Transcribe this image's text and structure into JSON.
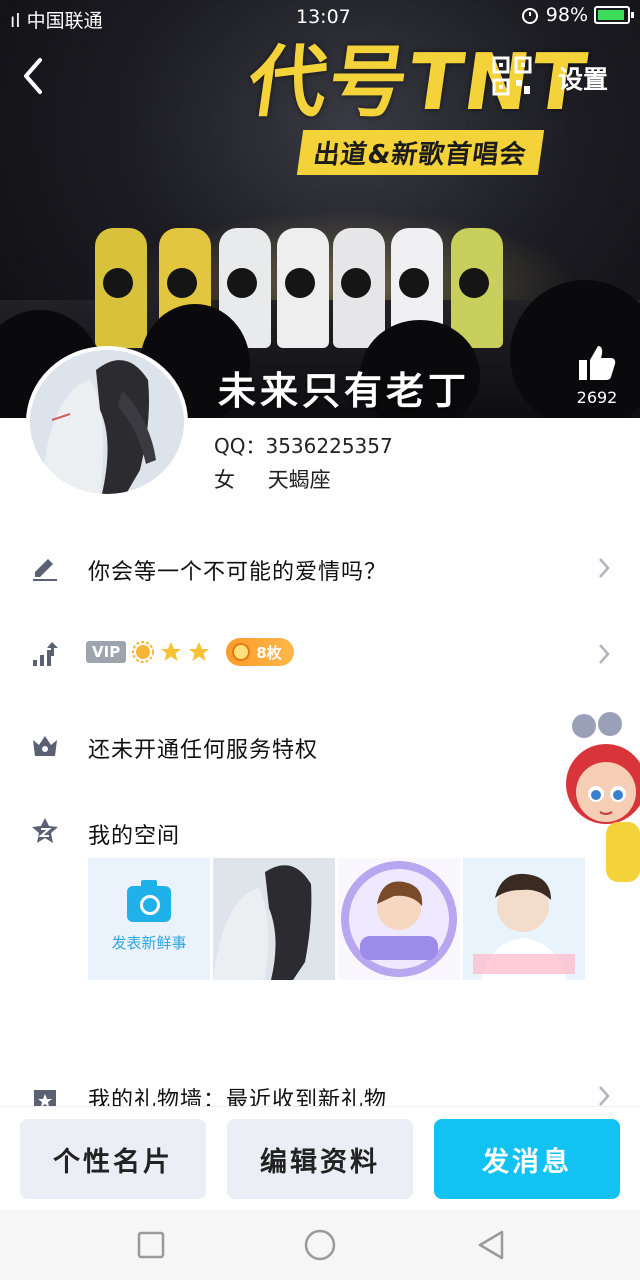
{
  "status_bar": {
    "carrier": "ıl 中国联通",
    "time": "13:07",
    "battery": "98%",
    "icons": [
      "signal-icon",
      "wifi-icon",
      "alarm-icon",
      "battery-icon"
    ]
  },
  "header": {
    "back_icon": "chevron-left-icon",
    "qr_icon": "qr-code-icon",
    "settings_label": "设置",
    "cover_logo": "代号TNT",
    "cover_subtitle": "出道&新歌首唱会"
  },
  "profile": {
    "nickname": "未来只有老丁",
    "like_icon": "thumbs-up-icon",
    "like_count": "2692",
    "qq_label": "QQ：3536225357",
    "gender": "女",
    "constellation": "天蝎座"
  },
  "rows": {
    "signature": {
      "icon": "pencil-icon",
      "text": "你会等一个不可能的爱情吗？"
    },
    "level": {
      "icon": "level-up-icon",
      "vip": "VIP",
      "medal_count": "8枚"
    },
    "services": {
      "icon": "crown-icon",
      "text": "还未开通任何服务特权"
    },
    "space": {
      "icon": "qzone-icon",
      "text": "我的空间",
      "post_label": "发表新鲜事",
      "photos": [
        "photo-1",
        "photo-2",
        "photo-3"
      ]
    },
    "gifts": {
      "icon": "gift-icon",
      "text": "我的礼物墙：最近收到新礼物"
    }
  },
  "actions": {
    "card": "个性名片",
    "edit": "编辑资料",
    "message": "发消息"
  },
  "colors": {
    "accent": "#12c2f2",
    "cover_yellow": "#f3d23a",
    "level_orange": "#ff9b2b"
  }
}
